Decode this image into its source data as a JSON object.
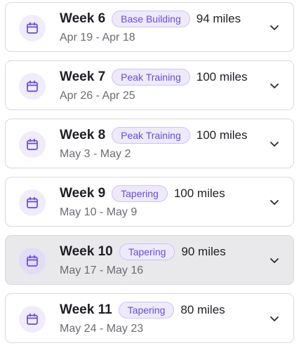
{
  "weeks": [
    {
      "title": "Week 6",
      "phase": "Base Building",
      "miles": "94 miles",
      "dates": "Apr 19 - Apr 18",
      "selected": false
    },
    {
      "title": "Week 7",
      "phase": "Peak Training",
      "miles": "100 miles",
      "dates": "Apr 26 - Apr 25",
      "selected": false
    },
    {
      "title": "Week 8",
      "phase": "Peak Training",
      "miles": "100 miles",
      "dates": "May 3 - May 2",
      "selected": false
    },
    {
      "title": "Week 9",
      "phase": "Tapering",
      "miles": "100 miles",
      "dates": "May 10 - May 9",
      "selected": false
    },
    {
      "title": "Week 10",
      "phase": "Tapering",
      "miles": "90 miles",
      "dates": "May 17 - May 16",
      "selected": true
    },
    {
      "title": "Week 11",
      "phase": "Tapering",
      "miles": "80 miles",
      "dates": "May 24 - May 23",
      "selected": false
    }
  ],
  "icons": {
    "week": "calendar-icon",
    "expand": "chevron-down-icon"
  },
  "colors": {
    "accent": "#6a4bd6",
    "badge_bg": "#eeeafc",
    "selected_bg": "#e9e9eb",
    "icon_circle": "#f0ecfb"
  }
}
